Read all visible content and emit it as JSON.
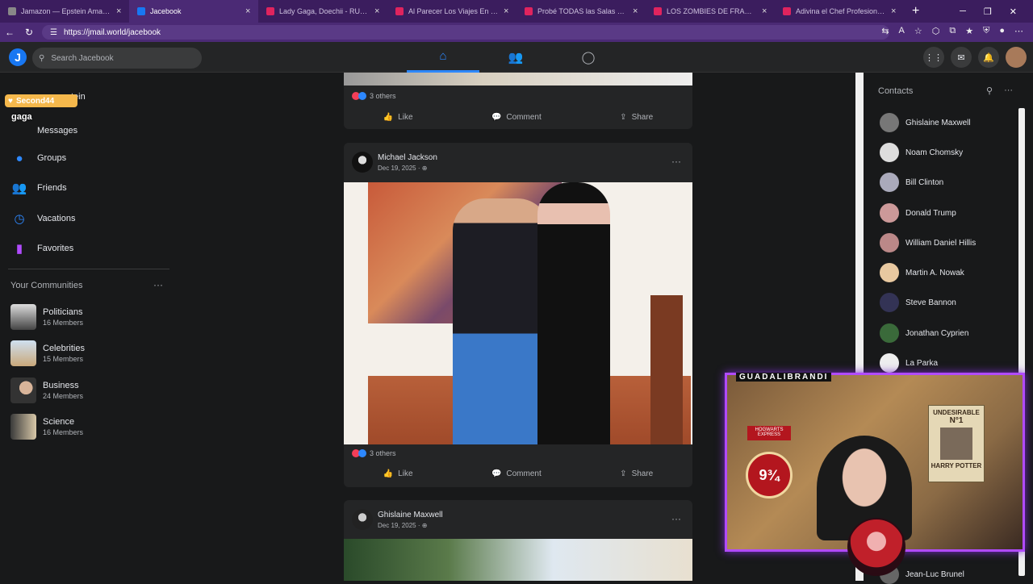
{
  "browser": {
    "tabs": [
      {
        "label": "Jamazon — Epstein Amazon Orde",
        "color": "#888888",
        "active": false
      },
      {
        "label": "Jacebook",
        "color": "#1877f2",
        "active": true
      },
      {
        "label": "Lady Gaga, Doechii - RUNWAY (Of",
        "color": "#e0245e",
        "active": false
      },
      {
        "label": "Al Parecer Los Viajes En El Tiempo",
        "color": "#e0245e",
        "active": false
      },
      {
        "label": "Probé TODAS las Salas de Cine en",
        "color": "#e0245e",
        "active": false
      },
      {
        "label": "LOS ZOMBIES DE FRANKFURT (JAP",
        "color": "#e0245e",
        "active": false
      },
      {
        "label": "Adivina el Chef Profesional - YouTu",
        "color": "#e0245e",
        "active": false
      }
    ],
    "url": "https://jmail.world/jacebook"
  },
  "header": {
    "logo": "J",
    "search_placeholder": "Search Jacebook"
  },
  "leftnav": {
    "overlay_badge": "Second44",
    "overlay_tag": "gaga",
    "partial_item": "tein",
    "items": [
      {
        "label": "Messages",
        "icon": "messages-icon"
      },
      {
        "label": "Groups",
        "icon": "groups-icon"
      },
      {
        "label": "Friends",
        "icon": "friends-icon"
      },
      {
        "label": "Vacations",
        "icon": "vacations-icon"
      },
      {
        "label": "Favorites",
        "icon": "favorites-icon"
      }
    ],
    "communities_title": "Your Communities",
    "communities": [
      {
        "name": "Politicians",
        "members": "16 Members"
      },
      {
        "name": "Celebrities",
        "members": "15 Members"
      },
      {
        "name": "Business",
        "members": "24 Members"
      },
      {
        "name": "Science",
        "members": "16 Members"
      }
    ]
  },
  "feed": {
    "post0": {
      "reactions": "3 others"
    },
    "post1": {
      "author": "Michael Jackson",
      "date": "Dec 19, 2025 · ",
      "reactions": "3 others"
    },
    "post2": {
      "author": "Ghislaine Maxwell",
      "date": "Dec 19, 2025 · "
    },
    "actions": {
      "like": "Like",
      "comment": "Comment",
      "share": "Share"
    }
  },
  "contacts": {
    "title": "Contacts",
    "list": [
      "Ghislaine Maxwell",
      "Noam Chomsky",
      "Bill Clinton",
      "Donald Trump",
      "William Daniel Hillis",
      "Martin A. Nowak",
      "Steve Bannon",
      "Jonathan Cyprien",
      "La Parka",
      "Jean-Luc Brunel"
    ]
  },
  "stream": {
    "streamer": "GUADALIBRANDI",
    "poster_title": "UNDESIRABLE",
    "poster_number": "N°1",
    "poster_name": "HARRY POTTER",
    "platform_sign": "9¾",
    "train_sign": "HOGWARTS EXPRESS"
  }
}
